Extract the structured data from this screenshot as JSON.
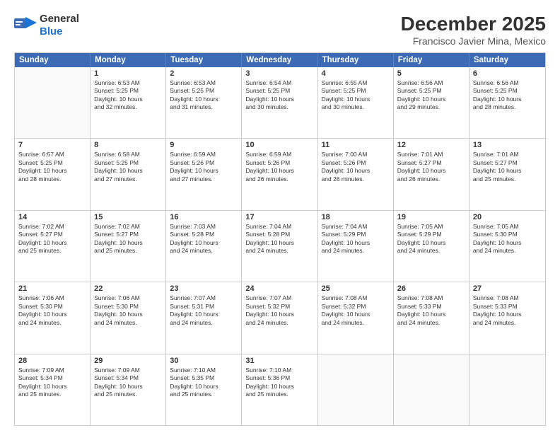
{
  "header": {
    "logo_general": "General",
    "logo_blue": "Blue",
    "main_title": "December 2025",
    "subtitle": "Francisco Javier Mina, Mexico"
  },
  "calendar": {
    "days_of_week": [
      "Sunday",
      "Monday",
      "Tuesday",
      "Wednesday",
      "Thursday",
      "Friday",
      "Saturday"
    ],
    "rows": [
      [
        {
          "day": "",
          "info": ""
        },
        {
          "day": "1",
          "info": "Sunrise: 6:53 AM\nSunset: 5:25 PM\nDaylight: 10 hours\nand 32 minutes."
        },
        {
          "day": "2",
          "info": "Sunrise: 6:53 AM\nSunset: 5:25 PM\nDaylight: 10 hours\nand 31 minutes."
        },
        {
          "day": "3",
          "info": "Sunrise: 6:54 AM\nSunset: 5:25 PM\nDaylight: 10 hours\nand 30 minutes."
        },
        {
          "day": "4",
          "info": "Sunrise: 6:55 AM\nSunset: 5:25 PM\nDaylight: 10 hours\nand 30 minutes."
        },
        {
          "day": "5",
          "info": "Sunrise: 6:56 AM\nSunset: 5:25 PM\nDaylight: 10 hours\nand 29 minutes."
        },
        {
          "day": "6",
          "info": "Sunrise: 6:56 AM\nSunset: 5:25 PM\nDaylight: 10 hours\nand 28 minutes."
        }
      ],
      [
        {
          "day": "7",
          "info": "Sunrise: 6:57 AM\nSunset: 5:25 PM\nDaylight: 10 hours\nand 28 minutes."
        },
        {
          "day": "8",
          "info": "Sunrise: 6:58 AM\nSunset: 5:25 PM\nDaylight: 10 hours\nand 27 minutes."
        },
        {
          "day": "9",
          "info": "Sunrise: 6:59 AM\nSunset: 5:26 PM\nDaylight: 10 hours\nand 27 minutes."
        },
        {
          "day": "10",
          "info": "Sunrise: 6:59 AM\nSunset: 5:26 PM\nDaylight: 10 hours\nand 26 minutes."
        },
        {
          "day": "11",
          "info": "Sunrise: 7:00 AM\nSunset: 5:26 PM\nDaylight: 10 hours\nand 26 minutes."
        },
        {
          "day": "12",
          "info": "Sunrise: 7:01 AM\nSunset: 5:27 PM\nDaylight: 10 hours\nand 26 minutes."
        },
        {
          "day": "13",
          "info": "Sunrise: 7:01 AM\nSunset: 5:27 PM\nDaylight: 10 hours\nand 25 minutes."
        }
      ],
      [
        {
          "day": "14",
          "info": "Sunrise: 7:02 AM\nSunset: 5:27 PM\nDaylight: 10 hours\nand 25 minutes."
        },
        {
          "day": "15",
          "info": "Sunrise: 7:02 AM\nSunset: 5:27 PM\nDaylight: 10 hours\nand 25 minutes."
        },
        {
          "day": "16",
          "info": "Sunrise: 7:03 AM\nSunset: 5:28 PM\nDaylight: 10 hours\nand 24 minutes."
        },
        {
          "day": "17",
          "info": "Sunrise: 7:04 AM\nSunset: 5:28 PM\nDaylight: 10 hours\nand 24 minutes."
        },
        {
          "day": "18",
          "info": "Sunrise: 7:04 AM\nSunset: 5:29 PM\nDaylight: 10 hours\nand 24 minutes."
        },
        {
          "day": "19",
          "info": "Sunrise: 7:05 AM\nSunset: 5:29 PM\nDaylight: 10 hours\nand 24 minutes."
        },
        {
          "day": "20",
          "info": "Sunrise: 7:05 AM\nSunset: 5:30 PM\nDaylight: 10 hours\nand 24 minutes."
        }
      ],
      [
        {
          "day": "21",
          "info": "Sunrise: 7:06 AM\nSunset: 5:30 PM\nDaylight: 10 hours\nand 24 minutes."
        },
        {
          "day": "22",
          "info": "Sunrise: 7:06 AM\nSunset: 5:30 PM\nDaylight: 10 hours\nand 24 minutes."
        },
        {
          "day": "23",
          "info": "Sunrise: 7:07 AM\nSunset: 5:31 PM\nDaylight: 10 hours\nand 24 minutes."
        },
        {
          "day": "24",
          "info": "Sunrise: 7:07 AM\nSunset: 5:32 PM\nDaylight: 10 hours\nand 24 minutes."
        },
        {
          "day": "25",
          "info": "Sunrise: 7:08 AM\nSunset: 5:32 PM\nDaylight: 10 hours\nand 24 minutes."
        },
        {
          "day": "26",
          "info": "Sunrise: 7:08 AM\nSunset: 5:33 PM\nDaylight: 10 hours\nand 24 minutes."
        },
        {
          "day": "27",
          "info": "Sunrise: 7:08 AM\nSunset: 5:33 PM\nDaylight: 10 hours\nand 24 minutes."
        }
      ],
      [
        {
          "day": "28",
          "info": "Sunrise: 7:09 AM\nSunset: 5:34 PM\nDaylight: 10 hours\nand 25 minutes."
        },
        {
          "day": "29",
          "info": "Sunrise: 7:09 AM\nSunset: 5:34 PM\nDaylight: 10 hours\nand 25 minutes."
        },
        {
          "day": "30",
          "info": "Sunrise: 7:10 AM\nSunset: 5:35 PM\nDaylight: 10 hours\nand 25 minutes."
        },
        {
          "day": "31",
          "info": "Sunrise: 7:10 AM\nSunset: 5:36 PM\nDaylight: 10 hours\nand 25 minutes."
        },
        {
          "day": "",
          "info": ""
        },
        {
          "day": "",
          "info": ""
        },
        {
          "day": "",
          "info": ""
        }
      ]
    ]
  }
}
